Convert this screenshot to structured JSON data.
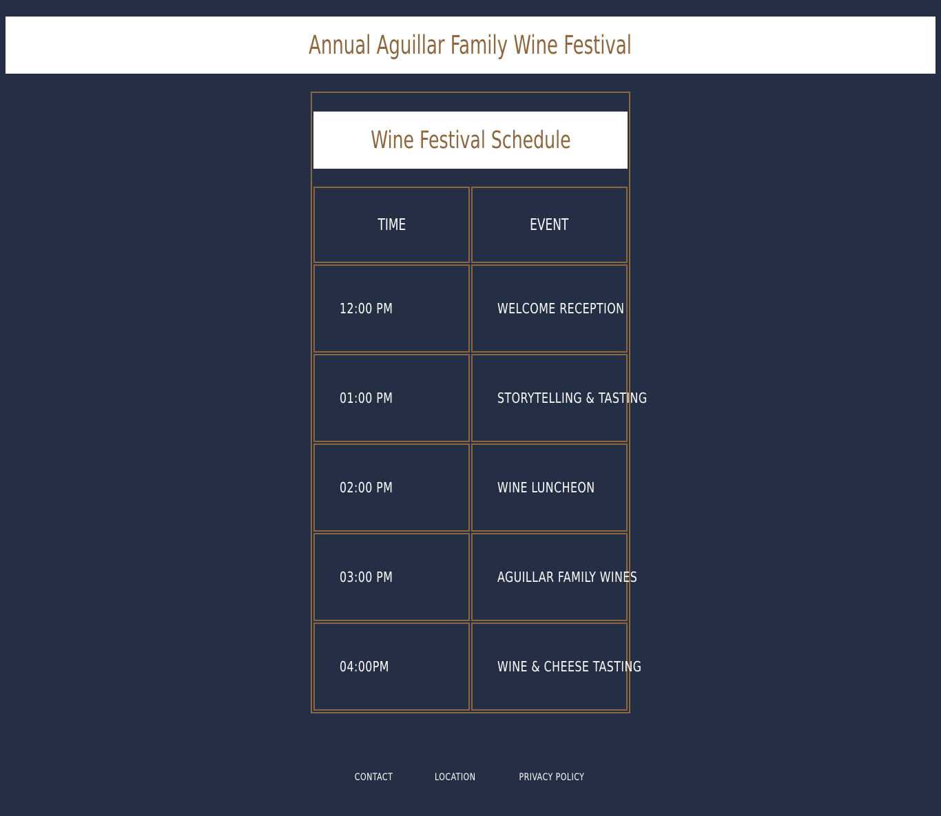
{
  "header": {
    "title": "Annual Aguillar Family Wine Festival"
  },
  "schedule": {
    "caption": "Wine Festival Schedule",
    "columns": [
      "TIME",
      "EVENT"
    ],
    "rows": [
      {
        "time": "12:00 PM",
        "event": "WELCOME RECEPTION"
      },
      {
        "time": "01:00 PM",
        "event": "STORYTELLING & TASTING"
      },
      {
        "time": "02:00 PM",
        "event": "WINE LUNCHEON"
      },
      {
        "time": "03:00 PM",
        "event": "AGUILLAR FAMILY WINES"
      },
      {
        "time": "04:00PM",
        "event": "WINE & CHEESE TASTING"
      }
    ]
  },
  "footer": {
    "links": [
      "CONTACT",
      "LOCATION",
      "PRIVACY POLICY"
    ]
  },
  "colors": {
    "background": "#242e44",
    "accent": "#8c673f",
    "header_bg": "#ffffff",
    "text": "#ffffff"
  }
}
